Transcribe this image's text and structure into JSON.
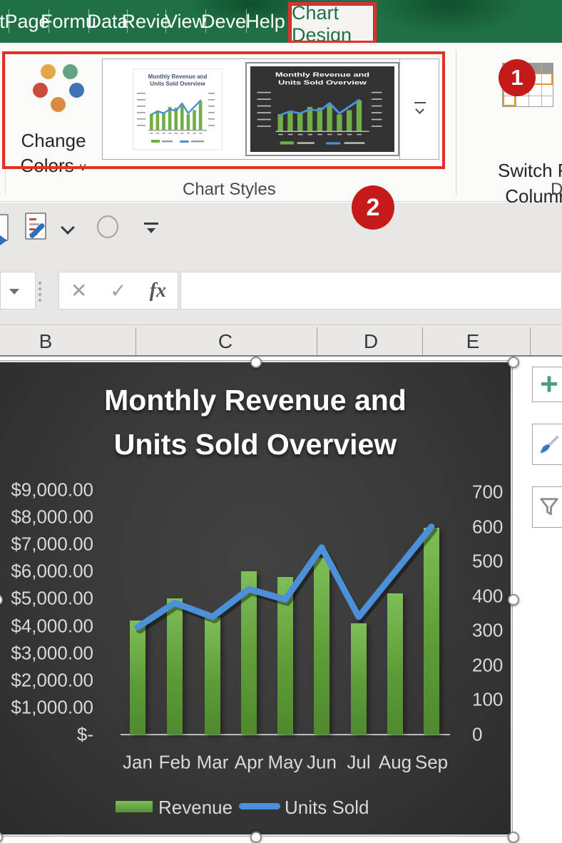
{
  "ribbon_tabs": {
    "items": [
      {
        "label": "t",
        "active": false
      },
      {
        "label": "Page",
        "active": false
      },
      {
        "label": "Formu",
        "active": false
      },
      {
        "label": "Data",
        "active": false
      },
      {
        "label": "Revie",
        "active": false
      },
      {
        "label": "View",
        "active": false
      },
      {
        "label": "Devel",
        "active": false
      },
      {
        "label": "Help",
        "active": false
      },
      {
        "label": "Chart Design",
        "active": true
      }
    ]
  },
  "ribbon": {
    "change_colors": {
      "line1": "Change",
      "line2": "Colors"
    },
    "chart_styles_group_label": "Chart Styles",
    "switch_row_column": {
      "line1": "Switch Ro",
      "line2": "Column"
    },
    "data_group_label": "Da",
    "annotation_badges": {
      "one": "1",
      "two": "2"
    },
    "annotation_color": "#c41a1a",
    "highlight_box_color": "#e03128",
    "change_colors_dot_colors": [
      "#e3a745",
      "#62a384",
      "#c84b3c",
      "#3f73b8",
      "#db8b3f"
    ]
  },
  "formula_bar": {
    "cancel": "✕",
    "enter": "✓",
    "fx": "fx"
  },
  "columns": [
    "B",
    "C",
    "D",
    "E"
  ],
  "side_buttons": {
    "plus": "+"
  },
  "chart_data": {
    "type": "combo-bar-line",
    "title": "Monthly Revenue and Units Sold Overview",
    "title_lines": [
      "Monthly Revenue and",
      "Units Sold Overview"
    ],
    "categories": [
      "Jan",
      "Feb",
      "Mar",
      "Apr",
      "May",
      "Jun",
      "Jul",
      "Aug",
      "Sep"
    ],
    "series": [
      {
        "name": "Revenue",
        "type": "bar",
        "axis": "left",
        "color": "#6faf46",
        "values": [
          4200,
          5000,
          4300,
          6000,
          5800,
          6500,
          4100,
          5200,
          7600
        ]
      },
      {
        "name": "Units Sold",
        "type": "line",
        "axis": "right",
        "color": "#4b90d9",
        "values": [
          310,
          380,
          340,
          420,
          390,
          540,
          340,
          470,
          600
        ]
      }
    ],
    "left_axis": {
      "min": 0,
      "max": 9000,
      "step": 1000,
      "ticks": [
        "$9,000.00",
        "$8,000.00",
        "$7,000.00",
        "$6,000.00",
        "$5,000.00",
        "$4,000.00",
        "$3,000.00",
        "$2,000.00",
        "$1,000.00",
        "$-"
      ]
    },
    "right_axis": {
      "min": 0,
      "max": 700,
      "step": 100,
      "ticks": [
        "700",
        "600",
        "500",
        "400",
        "300",
        "200",
        "100",
        "0"
      ]
    },
    "legend_position": "bottom",
    "background": "dark",
    "grid": false
  }
}
